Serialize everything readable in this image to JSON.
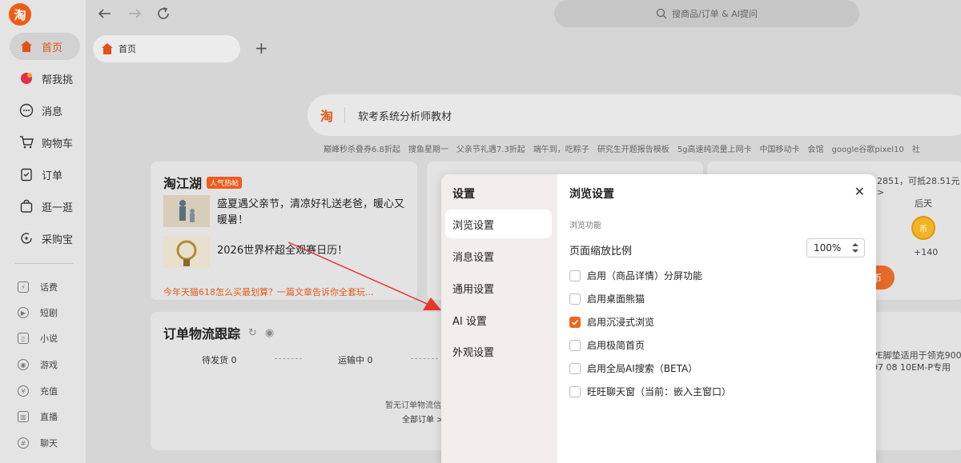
{
  "app": {
    "logo_char": "淘"
  },
  "sidebar": {
    "items": [
      {
        "label": "首页"
      },
      {
        "label": "帮我挑"
      },
      {
        "label": "消息"
      },
      {
        "label": "购物车"
      },
      {
        "label": "订单"
      },
      {
        "label": "逛一逛"
      },
      {
        "label": "采购宝"
      }
    ],
    "sub_items": [
      {
        "label": "话费"
      },
      {
        "label": "短剧"
      },
      {
        "label": "小说"
      },
      {
        "label": "游戏"
      },
      {
        "label": "充值"
      },
      {
        "label": "直播"
      },
      {
        "label": "聊天"
      }
    ]
  },
  "topbar": {
    "search_placeholder": "搜商品/订单 & AI提问",
    "tab_label": "首页"
  },
  "main_search": {
    "logo": "淘",
    "query": "软考系统分析师教材"
  },
  "hot_words": [
    "巅峰秒杀叠券6.8折起",
    "搜鱼星期一",
    "父亲节礼遇7.3折起",
    "端午到，吃粽子",
    "研究生开题报告模板",
    "5g高速纯流量上网卡",
    "中国移动卡",
    "会馆",
    "google谷歌pixel10",
    "社"
  ],
  "taojianghu": {
    "title": "淘江湖",
    "tag": "人气热帖",
    "posts": [
      {
        "text": "盛夏遇父亲节，清凉好礼送老爸，暖心又暖暑！"
      },
      {
        "text": "2026世界杯超全观赛日历！"
      }
    ],
    "link": "今年天猫618怎么买最划算？一篇文章告诉你全套玩..."
  },
  "tracking": {
    "title": "订单物流跟踪",
    "stat1": "待发货 0",
    "stat2": "运输中 0",
    "empty_text": "暂无订单物流信",
    "all_orders": "全部订单 >"
  },
  "right_card": {
    "points_text": "2851，可抵28.51元 >",
    "day_label": "后天",
    "coin_gain": "+140",
    "btn_text": "币",
    "coin_char": "币",
    "product_line1": "PE脚垫适用于领克900",
    "product_line2": "07 08 10EM-P专用"
  },
  "modal": {
    "sidebar_title": "设置",
    "nav": [
      {
        "label": "浏览设置"
      },
      {
        "label": "消息设置"
      },
      {
        "label": "通用设置"
      },
      {
        "label": "AI 设置"
      },
      {
        "label": "外观设置"
      }
    ],
    "title": "浏览设置",
    "close": "✕",
    "section_label": "浏览功能",
    "zoom_label": "页面缩放比例",
    "zoom_value": "100%",
    "options": [
      {
        "label": "启用（商品详情）分屏功能",
        "checked": false
      },
      {
        "label": "启用桌面熊猫",
        "checked": false
      },
      {
        "label": "启用沉浸式浏览",
        "checked": true
      },
      {
        "label": "启用极简首页",
        "checked": false
      },
      {
        "label": "启用全局AI搜索（BETA）",
        "checked": false
      },
      {
        "label": "旺旺聊天窗（当前：嵌入主窗口）",
        "checked": false
      }
    ]
  },
  "colors": {
    "accent": "#f0651d",
    "brand": "#f15a12"
  }
}
